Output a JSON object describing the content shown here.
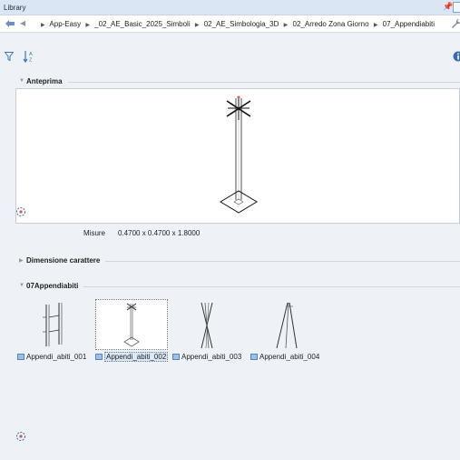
{
  "window": {
    "title": "Library",
    "pin_glyph": "$"
  },
  "path": {
    "crumbs": [
      "App-Easy",
      "_02_AE_Basic_2025_Simboli",
      "02_AE_Simbologia_3D",
      "02_Arredo Zona Giorno",
      "07_Appendiabiti"
    ]
  },
  "sections": {
    "preview": {
      "label": "Anteprima"
    },
    "size": {
      "label": "Dimensione carattere"
    },
    "group": {
      "label": "07Appendiabiti"
    }
  },
  "preview": {
    "measure_label": "Misure",
    "measure_value": "0.4700 x 0.4700 x 1.8000"
  },
  "items": [
    {
      "label": "Appendi_abiti_001",
      "selected": false
    },
    {
      "label": "Appendi_abiti_002",
      "selected": true
    },
    {
      "label": "Appendi_abiti_003",
      "selected": false
    },
    {
      "label": "Appendi_abiti_004",
      "selected": false
    }
  ],
  "icons": {
    "back": "back-arrow-icon",
    "forward": "forward-arrow-icon",
    "wrench": "wrench-icon",
    "filter": "filter-icon",
    "sort": "sort-az-icon",
    "info": "info-icon",
    "item": "part-icon"
  },
  "colors": {
    "accent": "#2f6db5",
    "panel": "#ffffff",
    "background": "#eef2f7"
  }
}
